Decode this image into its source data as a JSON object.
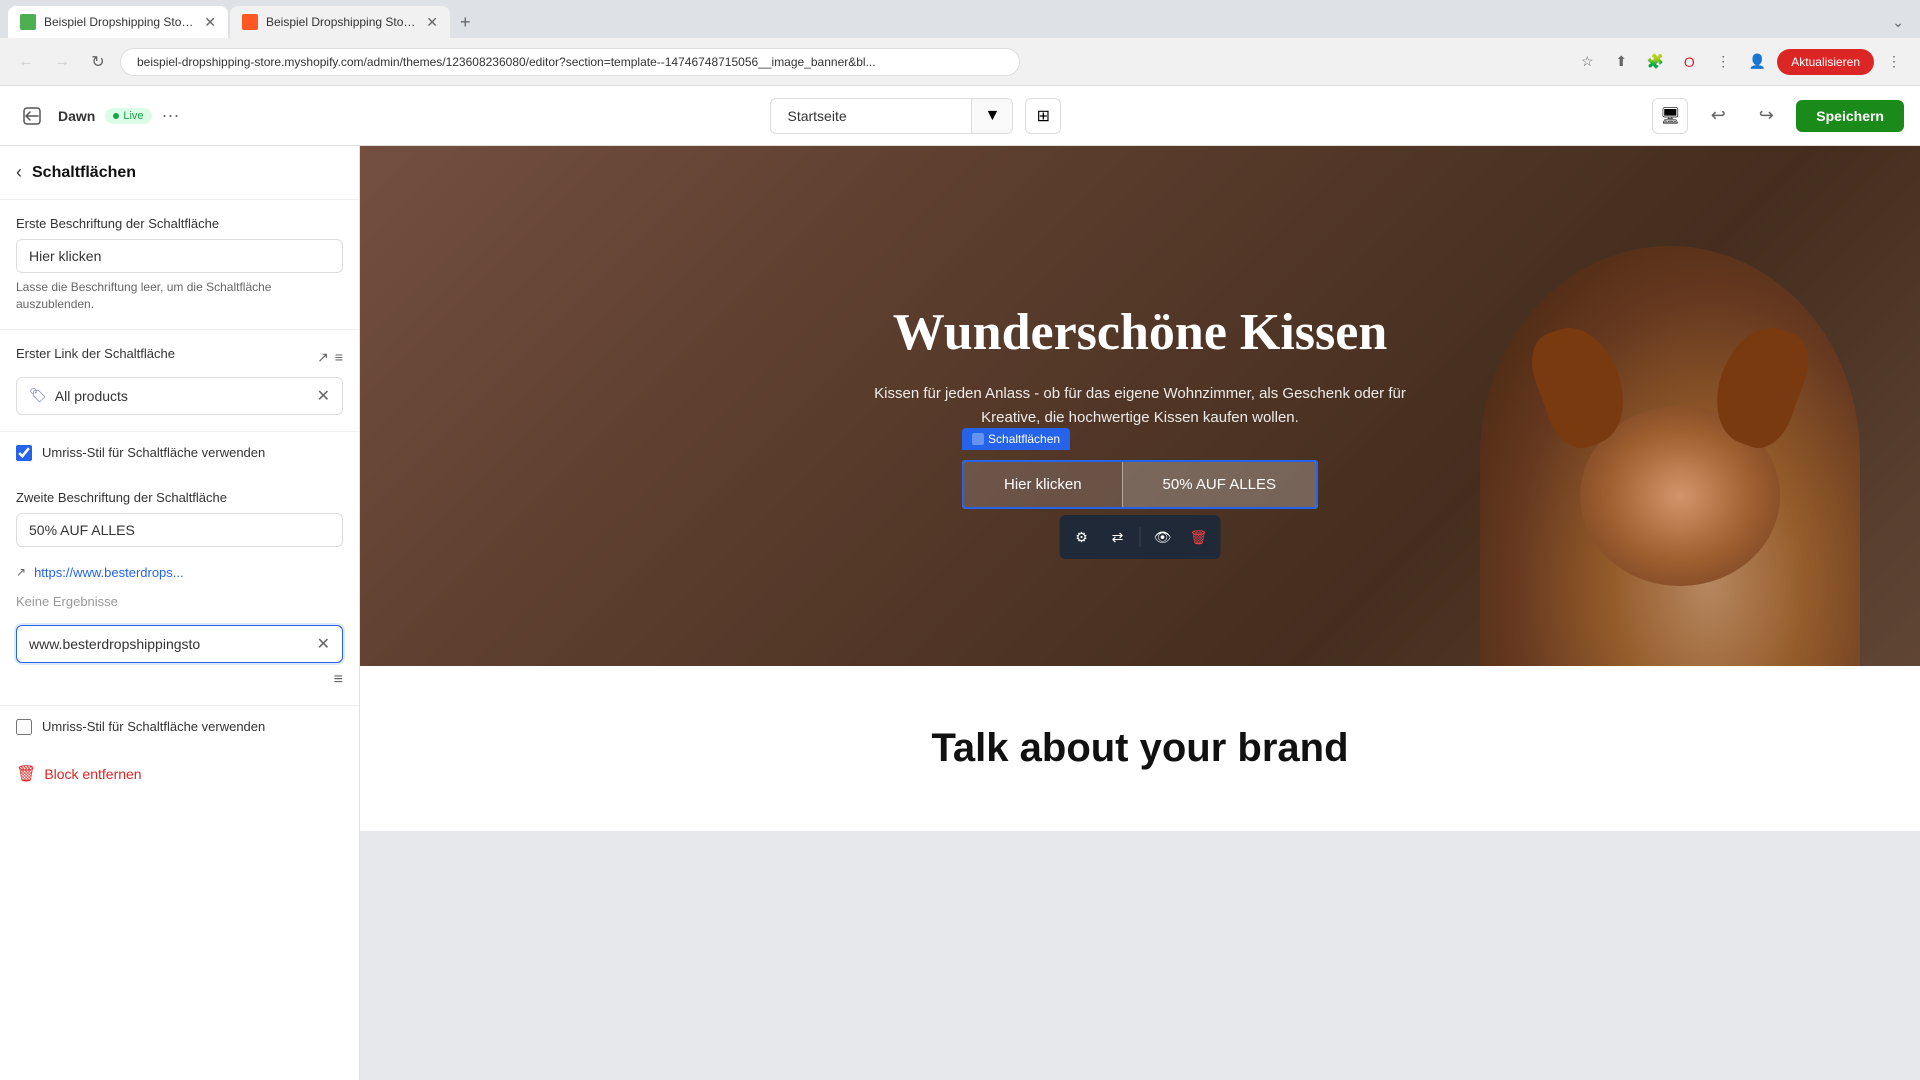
{
  "browser": {
    "tabs": [
      {
        "id": 1,
        "title": "Beispiel Dropshipping Store ·",
        "active": false
      },
      {
        "id": 2,
        "title": "Beispiel Dropshipping Store ·",
        "active": true
      }
    ],
    "address": "beispiel-dropshipping-store.myshopify.com/admin/themes/123608236080/editor?section=template--14746748715056__image_banner&bl...",
    "update_btn_label": "Aktualisieren"
  },
  "toolbar": {
    "theme_name": "Dawn",
    "live_label": "Live",
    "more_label": "···",
    "page_selector": "Startseite",
    "undo_label": "↩",
    "redo_label": "↪",
    "save_label": "Speichern"
  },
  "sidebar": {
    "title": "Schaltflächen",
    "first_btn_label": "Erste Beschriftung der Schaltfläche",
    "first_btn_value": "Hier klicken",
    "first_btn_hint": "Lasse die Beschriftung leer, um die Schaltfläche auszublenden.",
    "first_link_label": "Erster Link der Schaltfläche",
    "first_link_value": "All products",
    "outline_label": "Umriss-Stil für Schaltfläche verwenden",
    "second_btn_label": "Zweite Beschriftung der Schaltfläche",
    "second_btn_value": "50% AUF ALLES",
    "second_link_url": "https://www.besterdrops...",
    "no_results_text": "Keine Ergebnisse",
    "url_input_value": "www.besterdropshippingsto",
    "outline2_label": "Umriss-Stil für Schaltfläche verwenden",
    "block_remove_label": "Block entfernen"
  },
  "preview": {
    "schaltflachen_badge": "Schaltflächen",
    "hero_title": "Wunderschöne Kissen",
    "hero_subtitle": "Kissen für jeden Anlass - ob für das eigene Wohnzimmer, als Geschenk oder für\nKreative, die hochwertige Kissen kaufen wollen.",
    "btn1_label": "Hier klicken",
    "btn2_label": "50% AUF ALLES",
    "brand_title": "Talk about your brand"
  }
}
